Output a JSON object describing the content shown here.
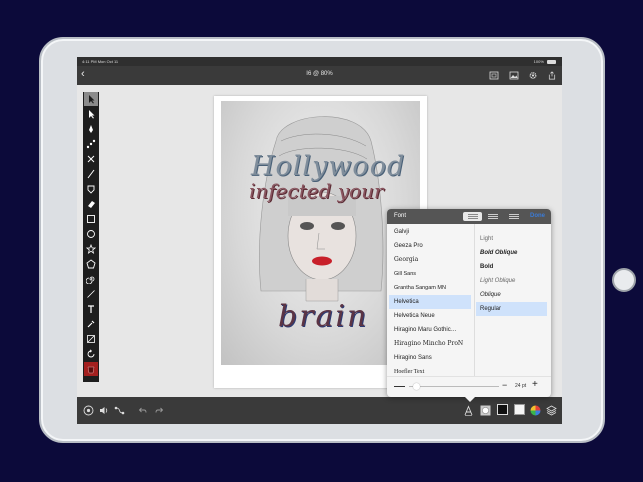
{
  "status": {
    "time": "4:11 PM   Mon Oct 11",
    "battery": "100%"
  },
  "document": {
    "title": "I6 @ 80%"
  },
  "artwork": {
    "line1": "Hollywood",
    "line2": "infected your",
    "line3": "brain"
  },
  "font_panel": {
    "title": "Font",
    "done_label": "Done",
    "fonts": [
      "Galvji",
      "Geeza Pro",
      "Georgia",
      "Gill Sans",
      "Grantha Sangam MN",
      "Helvetica",
      "Helvetica Neue",
      "Hiragino Maru Gothic…",
      "Hiragino Mincho ProN",
      "Hiragino Sans",
      "Hoefler Text"
    ],
    "selected_font": "Helvetica",
    "styles": [
      "Light",
      "Bold Oblique",
      "Bold",
      "Light Oblique",
      "Oblique",
      "Regular"
    ],
    "selected_style": "Regular",
    "size_label": "24 pt",
    "size_value": 24
  },
  "colors": {
    "accent": "#3b7bd6",
    "selection": "#cfe2fb",
    "tool_red": "#a3201f",
    "background": "#0c0a3a"
  }
}
